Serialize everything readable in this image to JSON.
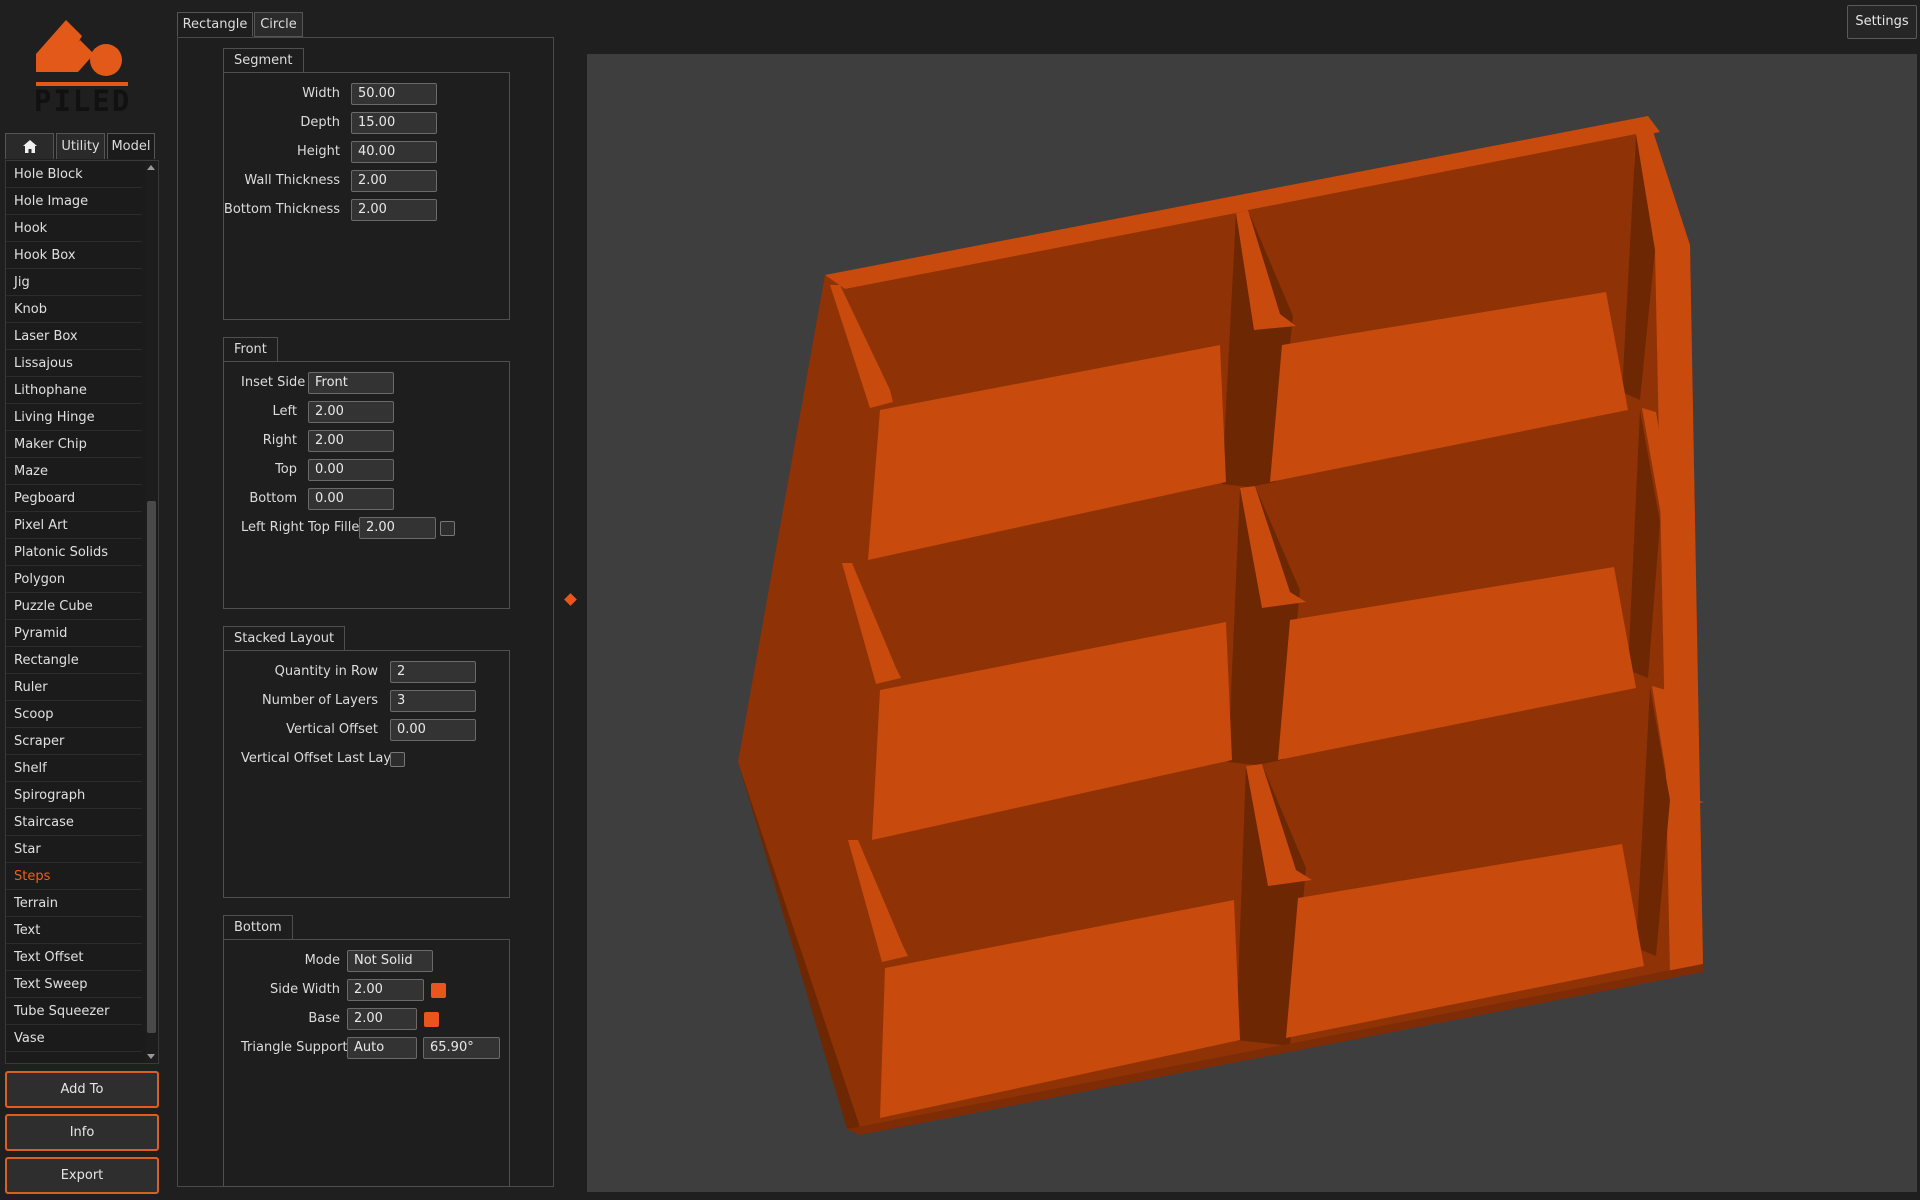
{
  "app": {
    "logo_text": "PILED"
  },
  "left_tabs": [
    {
      "icon": "home-icon",
      "label": ""
    },
    {
      "label": "Utility"
    },
    {
      "label": "Model"
    }
  ],
  "model_list": [
    "Hole Block",
    "Hole Image",
    "Hook",
    "Hook Box",
    "Jig",
    "Knob",
    "Laser Box",
    "Lissajous",
    "Lithophane",
    "Living Hinge",
    "Maker Chip",
    "Maze",
    "Pegboard",
    "Pixel Art",
    "Platonic Solids",
    "Polygon",
    "Puzzle Cube",
    "Pyramid",
    "Rectangle",
    "Ruler",
    "Scoop",
    "Scraper",
    "Shelf",
    "Spirograph",
    "Staircase",
    "Star",
    "Steps",
    "Terrain",
    "Text",
    "Text Offset",
    "Text Sweep",
    "Tube Squeezer",
    "Vase"
  ],
  "selected_model": "Steps",
  "actions": {
    "add_to": "Add To",
    "info": "Info",
    "export": "Export"
  },
  "panel_tabs": {
    "rectangle": "Rectangle",
    "circle": "Circle"
  },
  "segment": {
    "title": "Segment",
    "width_label": "Width",
    "width": "50.00",
    "depth_label": "Depth",
    "depth": "15.00",
    "height_label": "Height",
    "height": "40.00",
    "wall_label": "Wall Thickness",
    "wall": "2.00",
    "bottom_label": "Bottom Thickness",
    "bottom": "2.00"
  },
  "front": {
    "title": "Front",
    "inset_side_label": "Inset Side",
    "inset_side": "Front",
    "left_label": "Left",
    "left": "2.00",
    "right_label": "Right",
    "right": "2.00",
    "top_label": "Top",
    "top": "0.00",
    "bottom_label": "Bottom",
    "bottom": "0.00",
    "fillet_label": "Left Right Top Fillet",
    "fillet": "2.00"
  },
  "stacked": {
    "title": "Stacked Layout",
    "qty_label": "Quantity in Row",
    "qty": "2",
    "layers_label": "Number of Layers",
    "layers": "3",
    "voffset_label": "Vertical Offset",
    "voffset": "0.00",
    "voffset_last_label": "Vertical Offset Last Layer"
  },
  "bottom": {
    "title": "Bottom",
    "mode_label": "Mode",
    "mode": "Not Solid",
    "side_width_label": "Side Width",
    "side_width": "2.00",
    "base_label": "Base",
    "base": "2.00",
    "triangle_label": "Triangle Supports",
    "triangle": "Auto",
    "triangle_angle": "65.90°"
  },
  "viewport": {
    "settings": "Settings"
  },
  "colors": {
    "accent": "#e8561c",
    "model_light": "#c84a0c",
    "model_mid": "#8f3306",
    "model_dark": "#6e2703",
    "background": "#1f1f1f",
    "viewport": "#3e3e3e"
  }
}
